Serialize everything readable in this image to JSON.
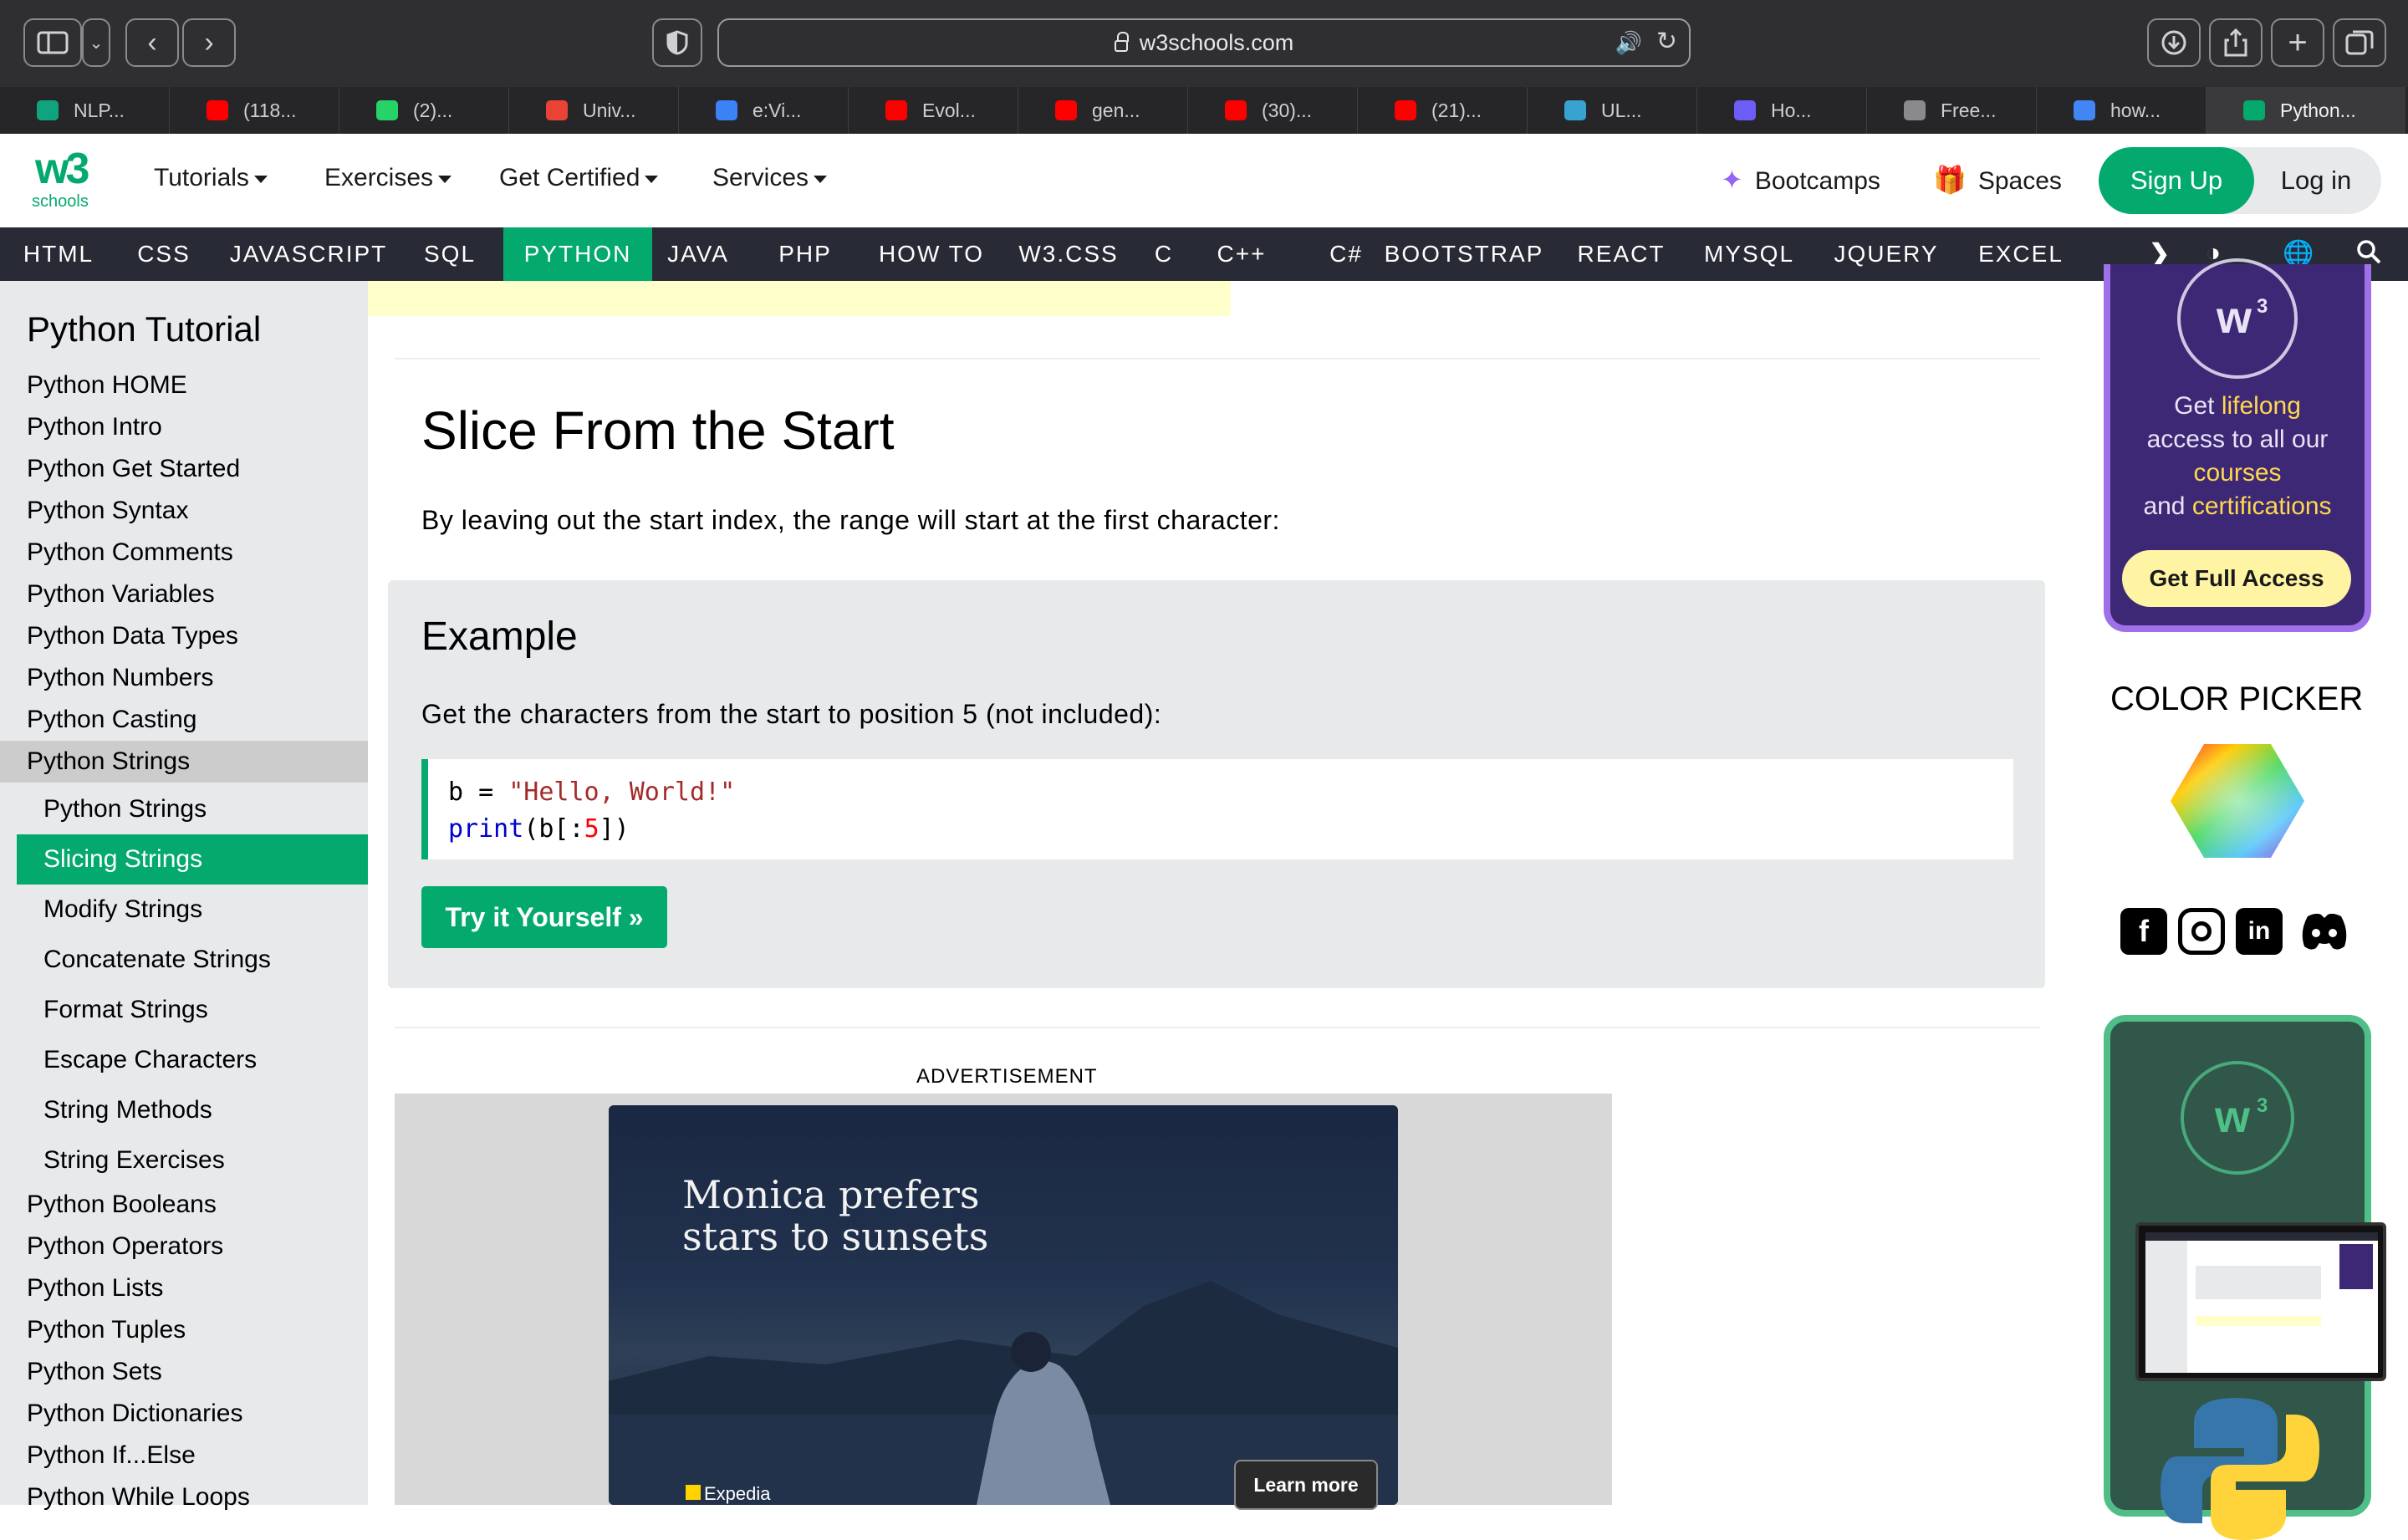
{
  "browser": {
    "url": "w3schools.com",
    "tabs": [
      {
        "label": "NLP...",
        "color": "#10a37f"
      },
      {
        "label": "(118...",
        "color": "#ff0000"
      },
      {
        "label": "(2)...",
        "color": "#25d366"
      },
      {
        "label": "Univ...",
        "color": "#ea4335"
      },
      {
        "label": "e:Vi...",
        "color": "#3b82f6"
      },
      {
        "label": "Evol...",
        "color": "#ff0000"
      },
      {
        "label": "gen...",
        "color": "#ff0000"
      },
      {
        "label": "(30)...",
        "color": "#ff0000"
      },
      {
        "label": "(21)...",
        "color": "#ff0000"
      },
      {
        "label": "UL...",
        "color": "#38a3d1"
      },
      {
        "label": "Ho...",
        "color": "#6d5df7"
      },
      {
        "label": "Free...",
        "color": "#8a8a8e"
      },
      {
        "label": "how...",
        "color": "#4285f4"
      },
      {
        "label": "Python...",
        "color": "#04aa6d"
      }
    ]
  },
  "topnav": {
    "logo_mark": "w3",
    "logo_sub": "schools",
    "links": [
      "Tutorials",
      "Exercises",
      "Get Certified",
      "Services"
    ],
    "bootcamps": "Bootcamps",
    "spaces": "Spaces",
    "signup": "Sign Up",
    "login": "Log in"
  },
  "subnav": {
    "items": [
      "HTML",
      "CSS",
      "JAVASCRIPT",
      "SQL",
      "PYTHON",
      "JAVA",
      "PHP",
      "HOW TO",
      "W3.CSS",
      "C",
      "C++",
      "C#",
      "BOOTSTRAP",
      "REACT",
      "MYSQL",
      "JQUERY",
      "EXCEL"
    ],
    "active": "PYTHON"
  },
  "sidebar": {
    "title": "Python Tutorial",
    "items_top": [
      "Python HOME",
      "Python Intro",
      "Python Get Started",
      "Python Syntax",
      "Python Comments",
      "Python Variables",
      "Python Data Types",
      "Python Numbers",
      "Python Casting",
      "Python Strings"
    ],
    "sub_items": [
      "Python Strings",
      "Slicing Strings",
      "Modify Strings",
      "Concatenate Strings",
      "Format Strings",
      "Escape Characters",
      "String Methods",
      "String Exercises"
    ],
    "items_bottom": [
      "Python Booleans",
      "Python Operators",
      "Python Lists",
      "Python Tuples",
      "Python Sets",
      "Python Dictionaries",
      "Python If...Else",
      "Python While Loops"
    ]
  },
  "main": {
    "heading": "Slice From the Start",
    "intro": "By leaving out the start index, the range will start at the first character:",
    "example": {
      "title": "Example",
      "desc": "Get the characters from the start to position 5 (not included):",
      "code_line1_var": "b = ",
      "code_line1_str": "\"Hello, World!\"",
      "code_line2_fn": "print",
      "code_line2_a": "(b[:",
      "code_line2_num": "5",
      "code_line2_b": "])",
      "try_button": "Try it Yourself »"
    },
    "ad_label": "ADVERTISEMENT",
    "ad": {
      "line1": "Monica prefers",
      "line2": "stars to sunsets",
      "cta": "Learn more",
      "brand": "Expedia"
    }
  },
  "right": {
    "promo_line1a": "Get ",
    "promo_line1b": "lifelong",
    "promo_line2": "access to all our",
    "promo_line3": "courses",
    "promo_line4a": "and ",
    "promo_line4b": "certifications",
    "promo_button": "Get Full Access",
    "color_picker_title": "COLOR PICKER"
  },
  "colors": {
    "accent": "#04aa6d",
    "subnav_bg": "#282a35",
    "sidebar_bg": "#e7e9eb"
  }
}
